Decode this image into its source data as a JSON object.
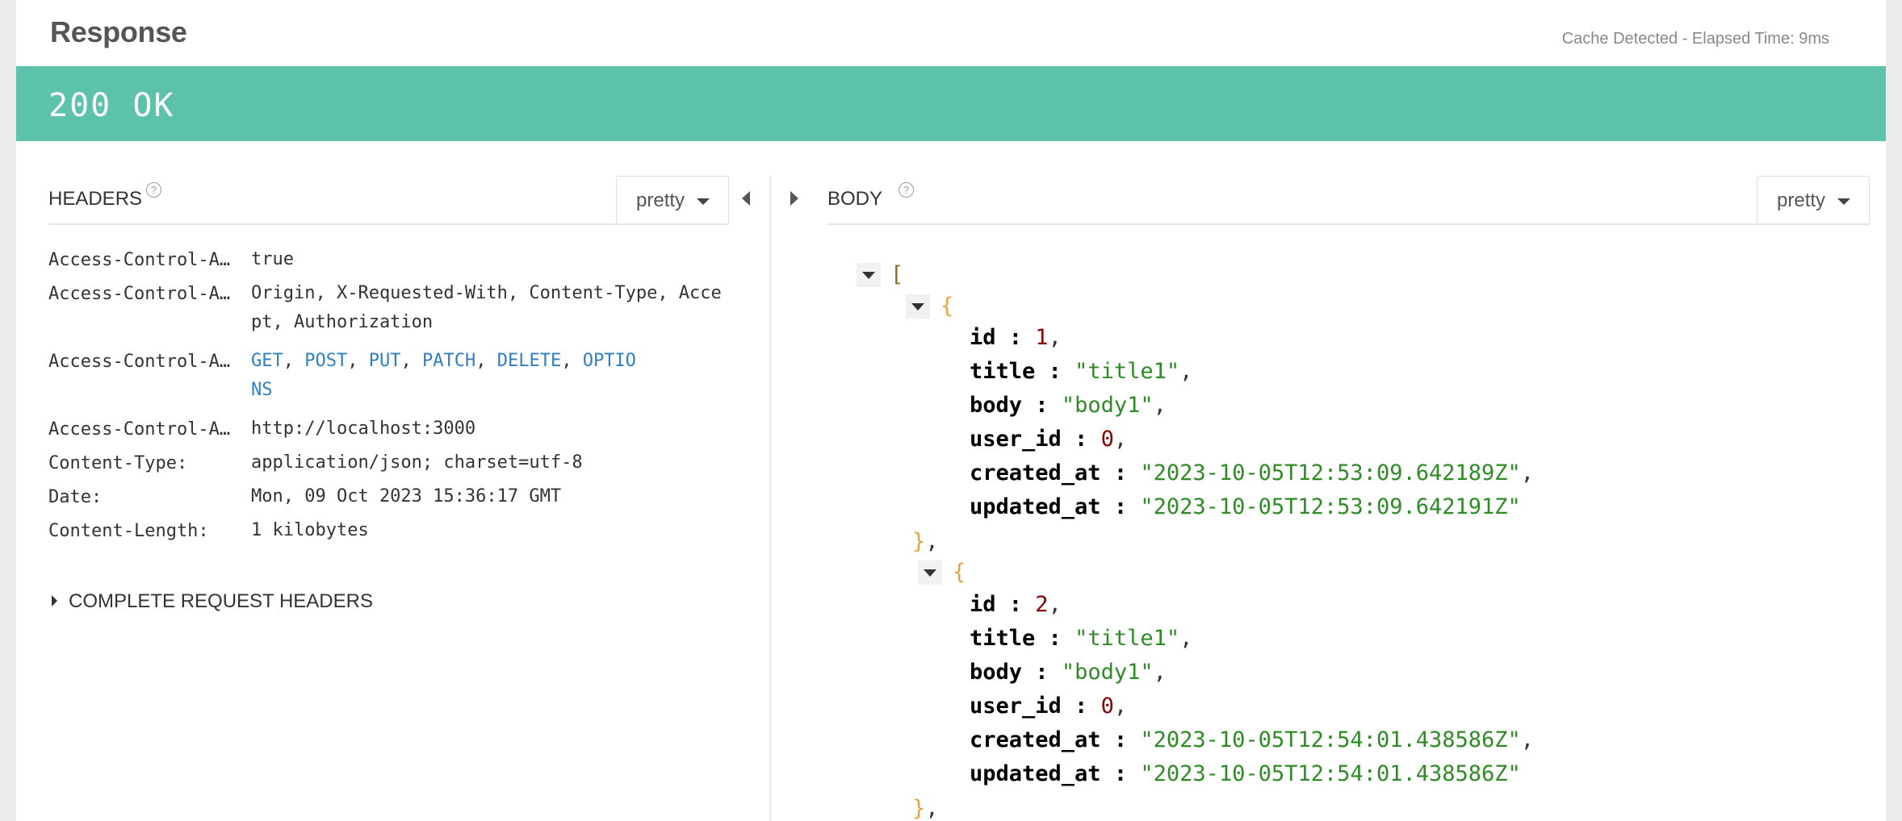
{
  "response": {
    "title": "Response",
    "cache_text": "Cache Detected -",
    "elapsed_text": "Elapsed Time: 9ms",
    "status": "200 OK"
  },
  "headers_panel": {
    "label": "HEADERS",
    "help": "?",
    "view_mode": "pretty",
    "rows": [
      {
        "key": "Access-Control-A…",
        "value": "true"
      },
      {
        "key": "Access-Control-A…",
        "value": "Origin, X-Requested-With, Content-Type, Accept, Authorization"
      },
      {
        "key": "Access-Control-A…",
        "methods": [
          "GET",
          "POST",
          "PUT",
          "PATCH",
          "DELETE"
        ],
        "methods_last": "OPTIO",
        "methods_last_wrap": "NS"
      },
      {
        "key": "Access-Control-A…",
        "value": "http://localhost:3000"
      },
      {
        "key": "Content-Type:",
        "value": "application/json; charset=utf-8"
      },
      {
        "key": "Date:",
        "value": "Mon, 09 Oct 2023 15:36:17 GMT"
      },
      {
        "key": "Content-Length:",
        "value": "1 kilobytes"
      }
    ],
    "complete_label": "COMPLETE REQUEST HEADERS"
  },
  "body_panel": {
    "label": "BODY",
    "help": "?",
    "view_mode": "pretty",
    "items": [
      {
        "id": "1",
        "title": "\"title1\"",
        "body": "\"body1\"",
        "user_id": "0",
        "created_at": "\"2023-10-05T12:53:09.642189Z\"",
        "updated_at": "\"2023-10-05T12:53:09.642191Z\""
      },
      {
        "id": "2",
        "title": "\"title1\"",
        "body": "\"body1\"",
        "user_id": "0",
        "created_at": "\"2023-10-05T12:54:01.438586Z\"",
        "updated_at": "\"2023-10-05T12:54:01.438586Z\""
      }
    ],
    "keys": {
      "id": "id",
      "title": "title",
      "body": "body",
      "user_id": "user_id",
      "created_at": "created_at",
      "updated_at": "updated_at"
    }
  },
  "colors": {
    "status_bar": "#5cc2a9",
    "string": "#2e8b26",
    "number": "#8b0000",
    "link": "#2f7fc1",
    "brace": "#e8a13c"
  }
}
